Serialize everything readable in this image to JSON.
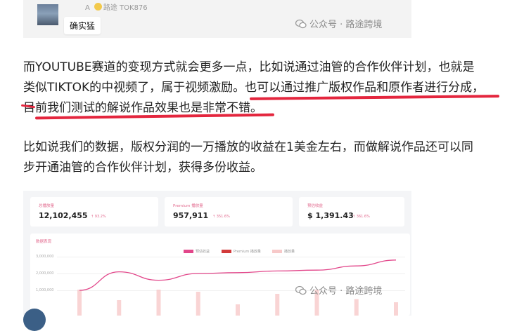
{
  "comment": {
    "username_prefix": "A",
    "username_name": "路途",
    "username_tag": "TOK876",
    "text": "确实猛"
  },
  "watermark": {
    "text": "公众号 · 路途跨境"
  },
  "paragraph1": {
    "line1": "而YOUTUBE赛道的变现方式就会更多一点，比如说通过油管的合作伙伴计划，也就是",
    "line2": "类似TIKTOK的中视频了，属于视频激励。也可以通过推广版权作品和原作者进行分成，",
    "line3": "目前我们测试的解说作品效果也是非常不错。"
  },
  "paragraph2": {
    "line1": "比如说我们的数据，版权分润的一万播放的收益在1美金左右，而做解说作品还可以同",
    "line2": "步开通油管的合作伙伴计划，获得多份收益。"
  },
  "dashboard": {
    "cards": [
      {
        "label": "总播放量",
        "value": "12,102,455",
        "change": "↑ 93.2%"
      },
      {
        "label": "Premium 播放量",
        "value": "957,911",
        "change": "↑ 351.6%"
      },
      {
        "label": "预估收益",
        "value": "$ 1,391.43",
        "change": "↑ 361.6%"
      }
    ],
    "panel_title": "数据表现",
    "legend": [
      "预估收益",
      "Premium 播放量",
      "播放量"
    ],
    "legend_colors": [
      "#e2468a",
      "#d23a3a",
      "#f7c9c9"
    ]
  },
  "chart_data": {
    "type": "line",
    "y_ticks": [
      "3,000,000",
      "2,000,000",
      "1,000,000"
    ],
    "series": [
      {
        "values": [
          1.0,
          2.1,
          1.6,
          2.0,
          2.05,
          2.15,
          2.2,
          2.45,
          2.8
        ]
      }
    ],
    "bars": [
      0.9,
      0.4,
      0.9,
      0.8,
      0.2,
      0.7,
      0.9,
      0.45,
      0.3
    ],
    "ylim": [
      0,
      3.3
    ]
  }
}
